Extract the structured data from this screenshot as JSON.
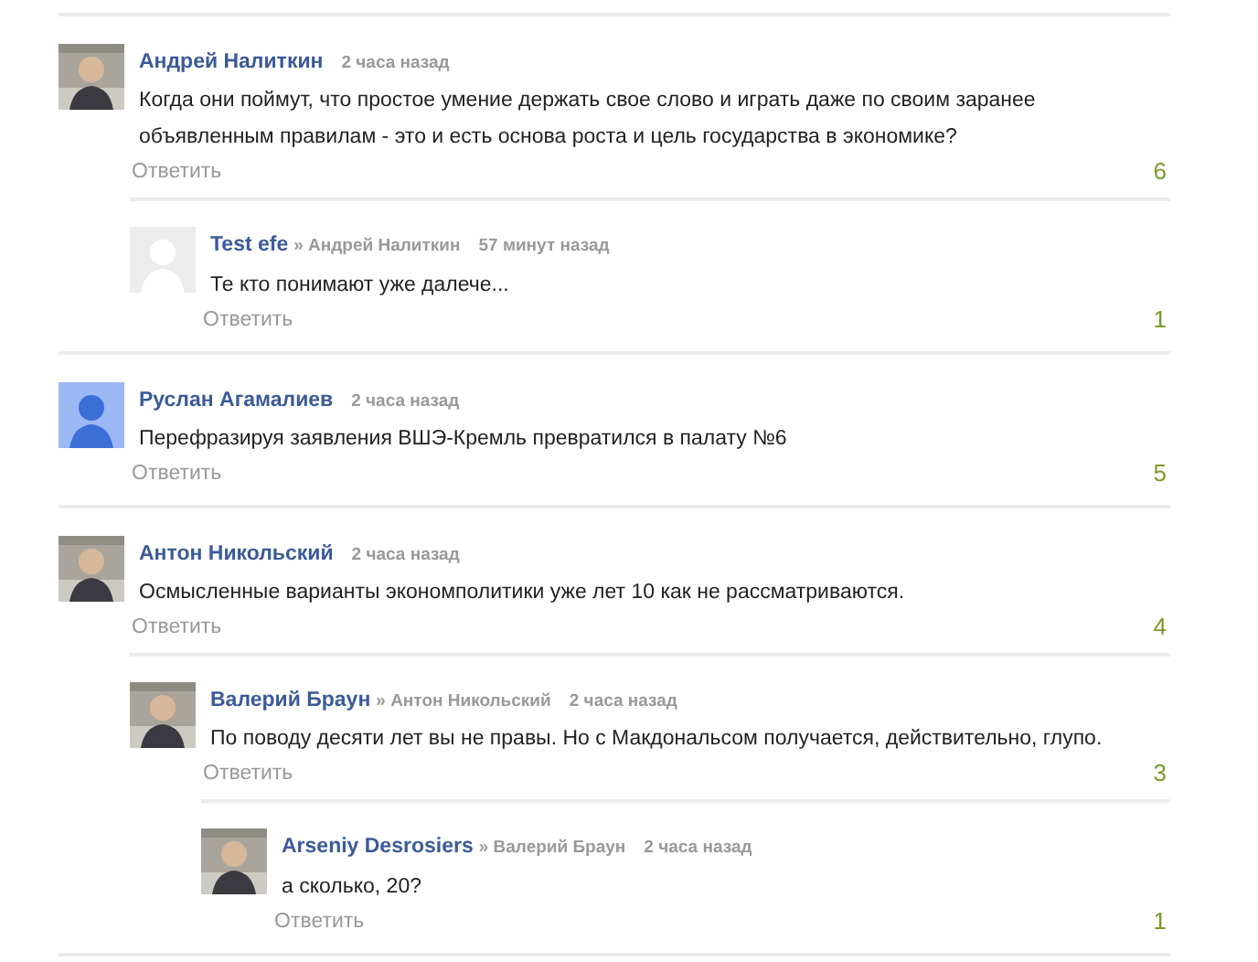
{
  "comments": [
    {
      "author": "Андрей Налиткин",
      "time": "2 часа назад",
      "text": "Когда они поймут, что простое умение держать свое слово и играть даже по своим заранее объявленным правилам - это и есть основа роста и цель государства в экономике?",
      "reply": "Ответить",
      "votes": "6",
      "children": [
        {
          "author": "Test efe",
          "reply_to": "» Андрей Налиткин",
          "time": "57 минут назад",
          "avatar": {
            "kind": "default-gray"
          },
          "text": "Те кто понимают уже далече...",
          "reply": "Ответить",
          "votes": "1"
        }
      ]
    },
    {
      "author": "Руслан Агамалиев",
      "time": "2 часа назад",
      "avatar": {
        "kind": "default-blue"
      },
      "text": "Перефразируя заявления ВШЭ-Кремль превратился в палату №6",
      "reply": "Ответить",
      "votes": "5"
    },
    {
      "author": "Антон Никольский",
      "time": "2 часа назад",
      "text": "Осмысленные варианты экономполитики уже лет 10 как не рассматриваются.",
      "reply": "Ответить",
      "votes": "4",
      "children": [
        {
          "author": "Валерий Браун",
          "reply_to": "» Антон Никольский",
          "time": "2 часа назад",
          "text": "По поводу десяти лет вы не правы. Но с Макдональсом получается, действительно, глупо.",
          "reply": "Ответить",
          "votes": "3",
          "children": [
            {
              "author": "Arseniy Desrosiers",
              "reply_to": "» Валерий Браун",
              "time": "2 часа назад",
              "text": "а сколько, 20?",
              "reply": "Ответить",
              "votes": "1"
            }
          ]
        }
      ]
    }
  ]
}
